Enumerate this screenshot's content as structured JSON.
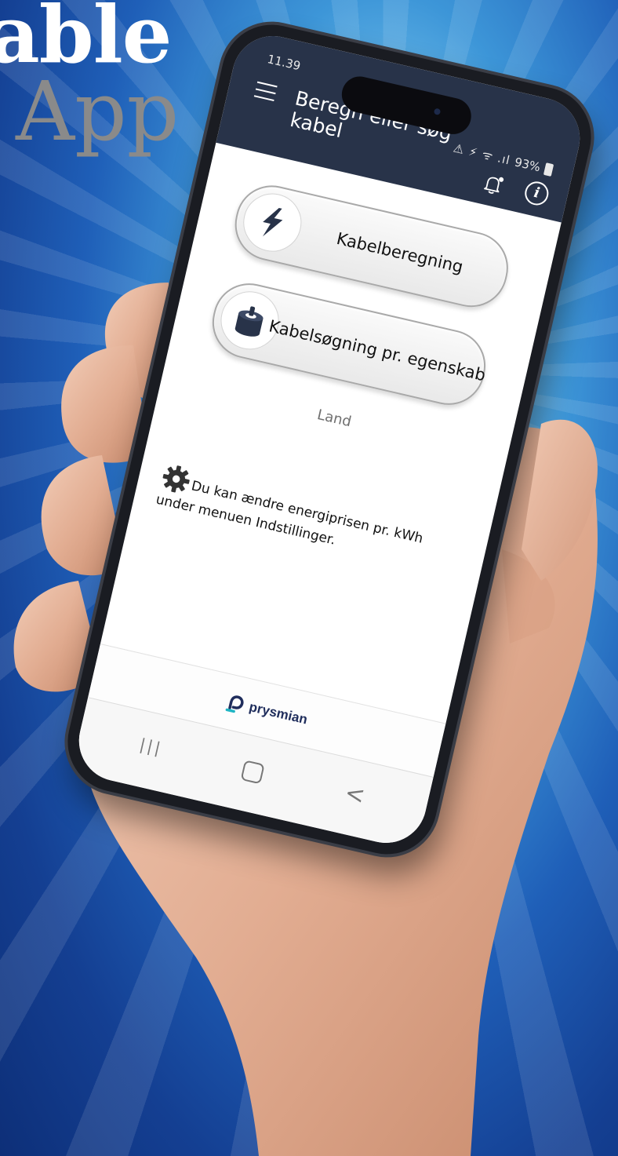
{
  "brand": {
    "title": "able",
    "subtitle": "App"
  },
  "status_bar": {
    "time": "11.39",
    "battery": "93%",
    "signal": "⚠ ⚡ ᯤ .ıl"
  },
  "header": {
    "title": "Beregn eller søg kabel"
  },
  "actions": [
    {
      "label": "Kabelberegning",
      "icon": "lightning-bolt-icon"
    },
    {
      "label": "Kabelsøgning pr. egenskab",
      "icon": "cable-drum-icon"
    }
  ],
  "country_label": "Land",
  "hint_text": "Du kan ændre energiprisen pr. kWh under menuen Indstillinger.",
  "footer": {
    "logo_text": "prysmian"
  },
  "navbar": {
    "recent": "|||",
    "back": "<"
  },
  "colors": {
    "header_bg": "#283349",
    "logo_accent": "#1fb5c4",
    "logo_main": "#1f2d5c"
  }
}
